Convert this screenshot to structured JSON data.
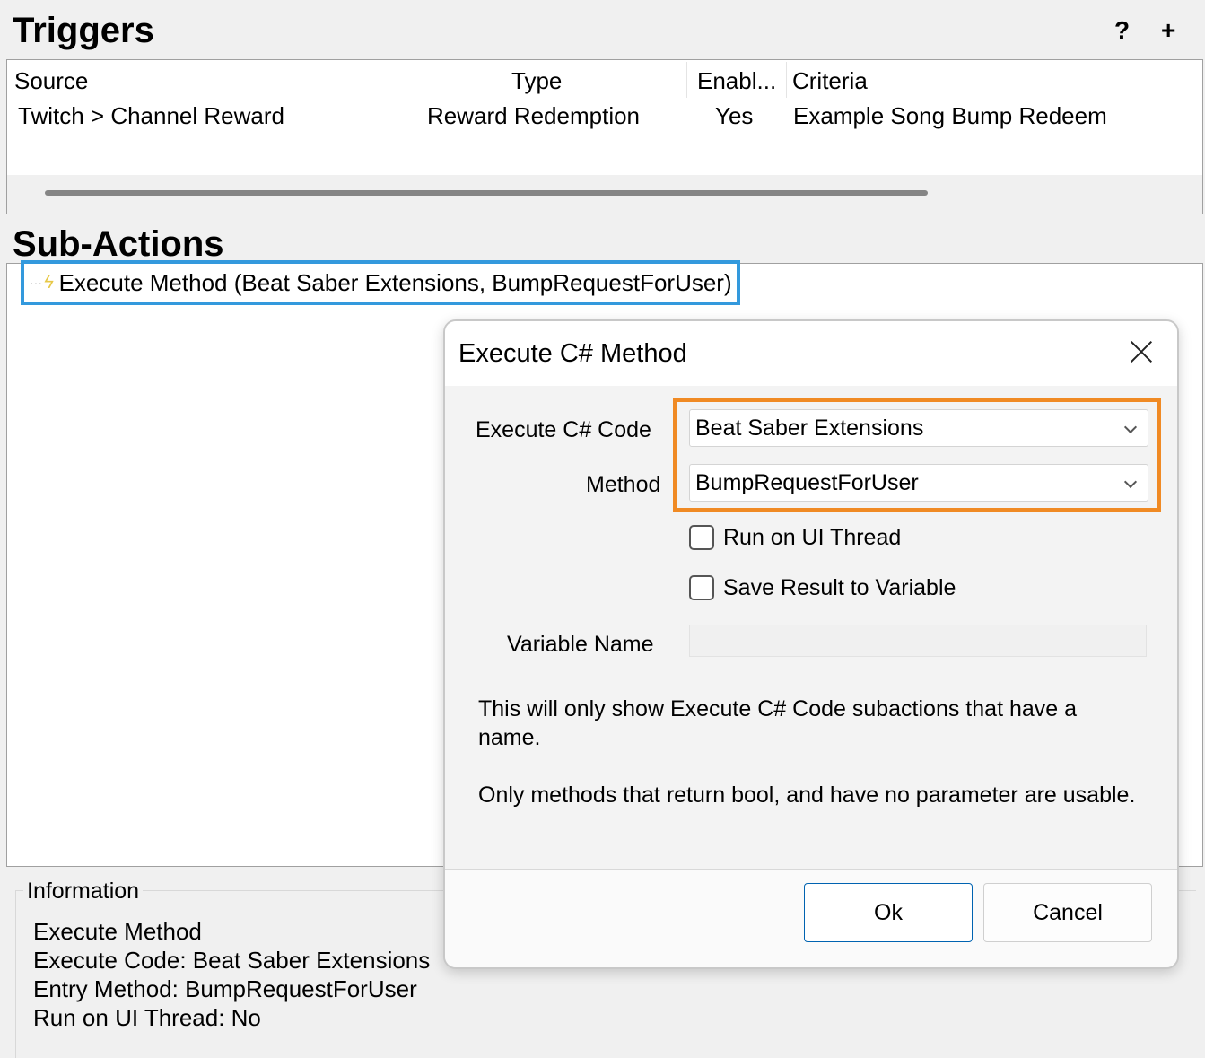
{
  "triggers": {
    "title": "Triggers",
    "help_label": "?",
    "add_label": "+",
    "columns": [
      "Source",
      "Type",
      "Enabl...",
      "Criteria"
    ],
    "rows": [
      {
        "source": "Twitch > Channel Reward",
        "type": "Reward Redemption",
        "enabled": "Yes",
        "criteria": "Example Song Bump Redeem"
      }
    ]
  },
  "subactions": {
    "title": "Sub-Actions",
    "items": [
      {
        "label": "Execute Method (Beat Saber Extensions, BumpRequestForUser)",
        "icon": "lightning-icon"
      }
    ]
  },
  "information": {
    "legend": "Information",
    "lines": [
      "Execute Method",
      "Execute Code: Beat Saber Extensions",
      "Entry Method: BumpRequestForUser",
      "Run on UI Thread: No"
    ]
  },
  "dialog": {
    "title": "Execute C# Method",
    "code_label": "Execute C# Code",
    "code_value": "Beat Saber Extensions",
    "method_label": "Method",
    "method_value": "BumpRequestForUser",
    "run_on_ui_thread_label": "Run on UI Thread",
    "run_on_ui_thread_checked": false,
    "save_result_label": "Save Result to Variable",
    "save_result_checked": false,
    "variable_name_label": "Variable Name",
    "variable_name_value": "",
    "note1": "This will only show Execute C# Code subactions that have a name.",
    "note2": "Only methods that return bool, and have no parameter are usable.",
    "ok_label": "Ok",
    "cancel_label": "Cancel"
  },
  "colors": {
    "highlight_subaction": "#3399dd",
    "highlight_fields": "#f08a24",
    "ok_border": "#0063b1"
  }
}
